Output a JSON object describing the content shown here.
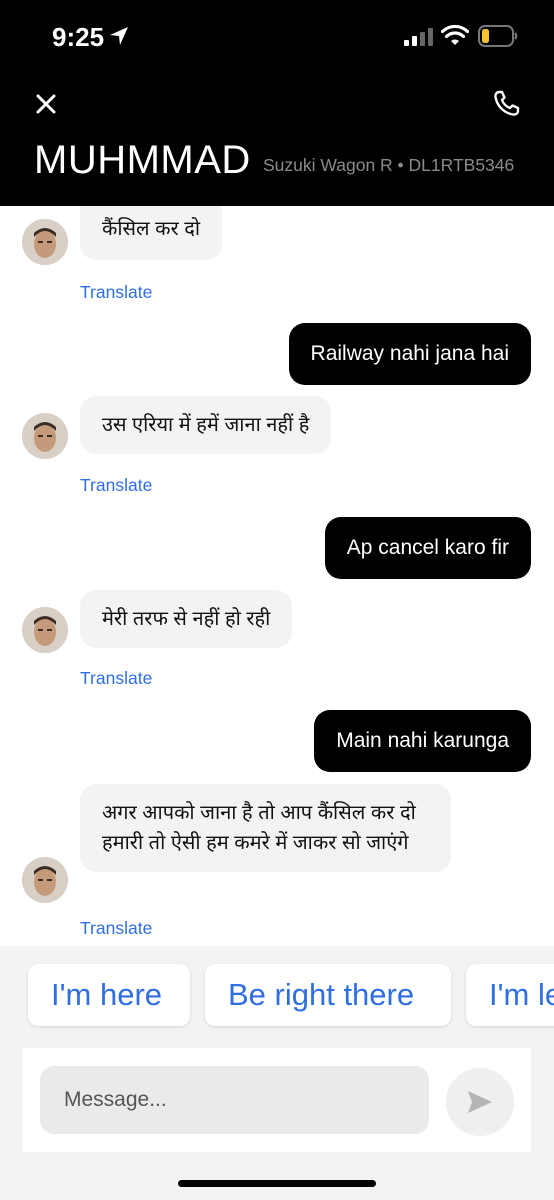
{
  "status_bar": {
    "time": "9:25",
    "icons": [
      "location-arrow-icon",
      "cellular-signal-icon",
      "wifi-icon",
      "battery-low-icon"
    ]
  },
  "header": {
    "close_icon": "close-icon",
    "call_icon": "phone-icon",
    "driver_name": "MUHMMAD",
    "vehicle": "Suzuki Wagon R • DL1RTB5346"
  },
  "messages": [
    {
      "direction": "incoming",
      "text": "कैंसिल कर दो",
      "translate": "Translate"
    },
    {
      "direction": "outgoing",
      "text": "Railway nahi jana hai"
    },
    {
      "direction": "incoming",
      "text": "उस एरिया में हमें जाना नहीं है",
      "translate": "Translate"
    },
    {
      "direction": "outgoing",
      "text": "Ap cancel karo fir"
    },
    {
      "direction": "incoming",
      "text": "मेरी तरफ से नहीं हो रही",
      "translate": "Translate"
    },
    {
      "direction": "outgoing",
      "text": "Main nahi karunga"
    },
    {
      "direction": "incoming",
      "text": "अगर आपको जाना है तो आप कैंसिल कर दो हमारी तो ऐसी हम कमरे में जाकर सो जाएंगे",
      "translate": "Translate"
    }
  ],
  "quick_replies": [
    "I'm here",
    "Be right there",
    "I'm le"
  ],
  "composer": {
    "placeholder": "Message...",
    "send_icon": "send-icon"
  },
  "colors": {
    "header_bg": "#000000",
    "link_blue": "#2f6fe0",
    "incoming_bubble": "#f3f3f3",
    "outgoing_bubble": "#000000"
  }
}
